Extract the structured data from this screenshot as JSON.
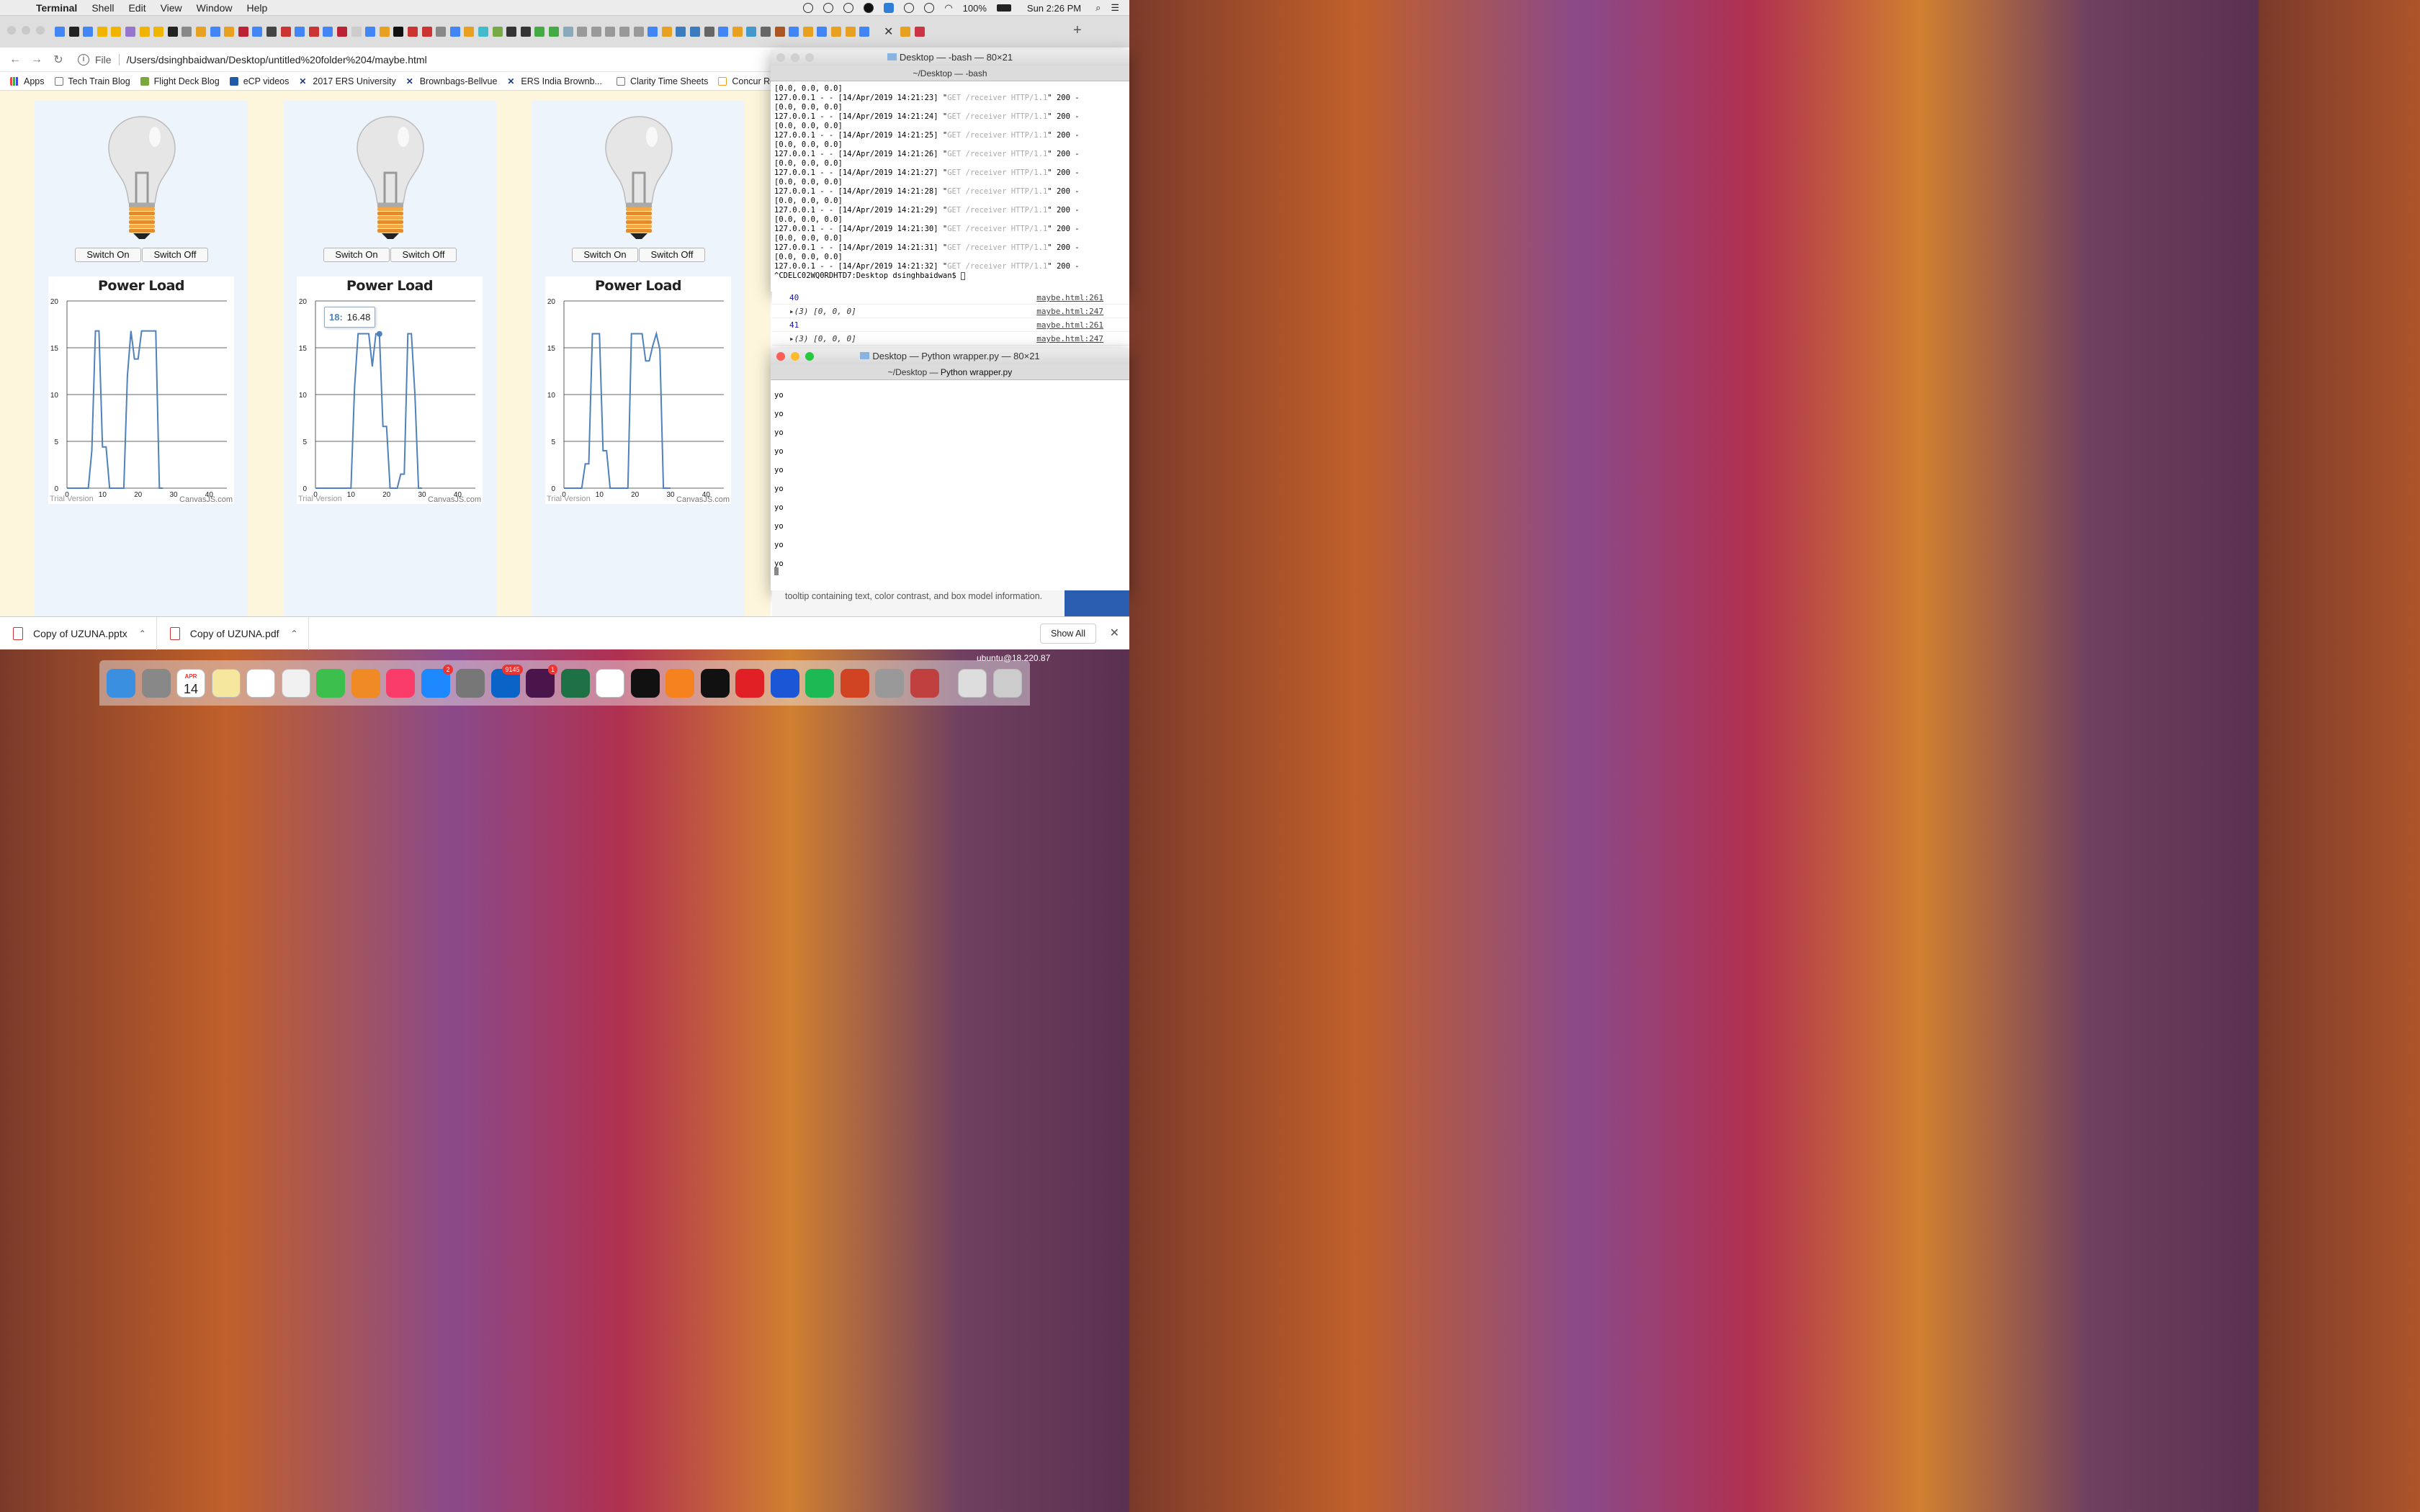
{
  "menubar": {
    "app": "Terminal",
    "items": [
      "Shell",
      "Edit",
      "View",
      "Window",
      "Help"
    ],
    "battery": "100%",
    "clock": "Sun 2:26 PM"
  },
  "browser": {
    "file_label": "File",
    "url": "/Users/dsinghbaidwan/Desktop/untitled%20folder%204/maybe.html",
    "bookmarks": [
      "Apps",
      "Tech Train Blog",
      "Flight Deck Blog",
      "eCP videos",
      "2017 ERS University",
      "Brownbags-Bellvue",
      "ERS India Brownb...",
      "Clarity Time Sheets",
      "Concur Refu"
    ]
  },
  "page": {
    "switch_on": "Switch On",
    "switch_off": "Switch Off",
    "chart_title": "Power Load",
    "trial": "Trial Version",
    "canvasjs": "CanvasJS.com",
    "tooltip_key": "18:",
    "tooltip_val": "16.48"
  },
  "chart_data": [
    {
      "type": "line",
      "title": "Power Load",
      "xlim": [
        0,
        45
      ],
      "ylim": [
        0,
        20
      ],
      "xticks": [
        0,
        10,
        20,
        30,
        40
      ],
      "yticks": [
        0,
        5,
        10,
        15,
        20
      ],
      "x": [
        0,
        1,
        2,
        3,
        4,
        5,
        6,
        7,
        8,
        9,
        10,
        11,
        12,
        13,
        14,
        15,
        16,
        17,
        18,
        19,
        20,
        21,
        22,
        23,
        24,
        25,
        26,
        27
      ],
      "y": [
        0,
        0,
        0,
        0,
        0,
        0,
        0,
        4,
        16.8,
        16.8,
        4.4,
        4.4,
        0,
        0,
        0,
        0,
        0,
        12,
        16.8,
        13.8,
        13.8,
        16.8,
        16.8,
        16.8,
        16.8,
        16.8,
        0,
        0
      ]
    },
    {
      "type": "line",
      "title": "Power Load",
      "xlim": [
        0,
        45
      ],
      "ylim": [
        0,
        20
      ],
      "xticks": [
        0,
        10,
        20,
        30,
        40
      ],
      "yticks": [
        0,
        5,
        10,
        15,
        20
      ],
      "x": [
        0,
        1,
        2,
        3,
        4,
        5,
        6,
        7,
        8,
        9,
        10,
        11,
        12,
        13,
        14,
        15,
        16,
        17,
        18,
        19,
        20,
        21,
        22,
        23,
        24,
        25,
        26,
        27,
        28,
        29,
        30
      ],
      "y": [
        0,
        0,
        0,
        0,
        0,
        0,
        0,
        0,
        0,
        0,
        0,
        10.8,
        16.5,
        16.5,
        16.5,
        16.5,
        13,
        16.5,
        16.48,
        6.6,
        6.6,
        0,
        0,
        0,
        1.5,
        1.5,
        16.5,
        16.5,
        10,
        0,
        0
      ]
    },
    {
      "type": "line",
      "title": "Power Load",
      "xlim": [
        0,
        45
      ],
      "ylim": [
        0,
        20
      ],
      "xticks": [
        0,
        10,
        20,
        30,
        40
      ],
      "yticks": [
        0,
        5,
        10,
        15,
        20
      ],
      "x": [
        0,
        1,
        2,
        3,
        4,
        5,
        6,
        7,
        8,
        9,
        10,
        11,
        12,
        13,
        14,
        15,
        16,
        17,
        18,
        19,
        20,
        21,
        22,
        23,
        24,
        25,
        26,
        27,
        28,
        29,
        30
      ],
      "y": [
        0,
        0,
        0,
        0,
        0,
        0,
        2.6,
        2.6,
        16.5,
        16.5,
        16.5,
        4,
        4,
        0,
        0,
        0,
        0,
        0,
        0,
        16.5,
        16.5,
        16.5,
        16.5,
        13.6,
        13.6,
        15.2,
        16.5,
        14.8,
        0,
        0,
        0
      ]
    }
  ],
  "terminal1": {
    "title": "Desktop — -bash — 80×21",
    "subtitle": "~/Desktop — -bash",
    "lines": [
      {
        "a": "[0.0, 0.0, 0.0]",
        "b": "",
        "c": ""
      },
      {
        "a": "127.0.0.1 - - [14/Apr/2019 14:21:23] \"",
        "b": "GET /receiver HTTP/1.1",
        "c": "\" 200 -"
      },
      {
        "a": "[0.0, 0.0, 0.0]",
        "b": "",
        "c": ""
      },
      {
        "a": "127.0.0.1 - - [14/Apr/2019 14:21:24] \"",
        "b": "GET /receiver HTTP/1.1",
        "c": "\" 200 -"
      },
      {
        "a": "[0.0, 0.0, 0.0]",
        "b": "",
        "c": ""
      },
      {
        "a": "127.0.0.1 - - [14/Apr/2019 14:21:25] \"",
        "b": "GET /receiver HTTP/1.1",
        "c": "\" 200 -"
      },
      {
        "a": "[0.0, 0.0, 0.0]",
        "b": "",
        "c": ""
      },
      {
        "a": "127.0.0.1 - - [14/Apr/2019 14:21:26] \"",
        "b": "GET /receiver HTTP/1.1",
        "c": "\" 200 -"
      },
      {
        "a": "[0.0, 0.0, 0.0]",
        "b": "",
        "c": ""
      },
      {
        "a": "127.0.0.1 - - [14/Apr/2019 14:21:27] \"",
        "b": "GET /receiver HTTP/1.1",
        "c": "\" 200 -"
      },
      {
        "a": "[0.0, 0.0, 0.0]",
        "b": "",
        "c": ""
      },
      {
        "a": "127.0.0.1 - - [14/Apr/2019 14:21:28] \"",
        "b": "GET /receiver HTTP/1.1",
        "c": "\" 200 -"
      },
      {
        "a": "[0.0, 0.0, 0.0]",
        "b": "",
        "c": ""
      },
      {
        "a": "127.0.0.1 - - [14/Apr/2019 14:21:29] \"",
        "b": "GET /receiver HTTP/1.1",
        "c": "\" 200 -"
      },
      {
        "a": "[0.0, 0.0, 0.0]",
        "b": "",
        "c": ""
      },
      {
        "a": "127.0.0.1 - - [14/Apr/2019 14:21:30] \"",
        "b": "GET /receiver HTTP/1.1",
        "c": "\" 200 -"
      },
      {
        "a": "[0.0, 0.0, 0.0]",
        "b": "",
        "c": ""
      },
      {
        "a": "127.0.0.1 - - [14/Apr/2019 14:21:31] \"",
        "b": "GET /receiver HTTP/1.1",
        "c": "\" 200 -"
      },
      {
        "a": "[0.0, 0.0, 0.0]",
        "b": "",
        "c": ""
      },
      {
        "a": "127.0.0.1 - - [14/Apr/2019 14:21:32] \"",
        "b": "GET /receiver HTTP/1.1",
        "c": "\" 200 -"
      },
      {
        "a": "^CDELC02WQ0RDHTD7:Desktop dsinghbaidwan$ ",
        "b": "",
        "c": ""
      }
    ]
  },
  "devtools": {
    "rows": [
      {
        "text": "40",
        "kind": "v",
        "src": "maybe.html:261"
      },
      {
        "text": "▸(3) [0, 0, 0]",
        "kind": "a",
        "src": "maybe.html:247"
      },
      {
        "text": "41",
        "kind": "v",
        "src": "maybe.html:261"
      },
      {
        "text": "▸(3) [0, 0, 0]",
        "kind": "a",
        "src": "maybe.html:247"
      }
    ],
    "bottom_text": "tooltip containing text, color contrast, and box model information."
  },
  "terminal2": {
    "title": "Desktop — Python wrapper.py — 80×21",
    "subtitle_prefix": "~/Desktop — ",
    "subtitle_bold": "Python wrapper.py",
    "lines": [
      "yo",
      "yo",
      "yo",
      "yo",
      "yo",
      "yo",
      "yo",
      "yo",
      "yo",
      "yo"
    ]
  },
  "downloads": {
    "items": [
      "Copy of UZUNA.pptx",
      "Copy of UZUNA.pdf"
    ],
    "show_all": "Show All"
  },
  "dock": {
    "ubuntu_label": "ubuntu@18.220.87",
    "calendar_month": "APR",
    "calendar_day": "14",
    "badges": {
      "appstore": "2",
      "outlook": "9145",
      "slack": "1"
    },
    "apps": [
      "Finder",
      "Launchpad",
      "Calendar",
      "Notes",
      "Reminders",
      "Photos",
      "FaceTime",
      "Books",
      "Music",
      "App Store",
      "System Preferences",
      "Outlook",
      "Slack",
      "Excel",
      "Chrome",
      "IntelliJ IDEA",
      "Sublime Text",
      "Terminal",
      "Acrobat",
      "BBEdit",
      "Spotify",
      "PowerPoint",
      "Keychain",
      "Remote Desktop",
      "Documents",
      "Trash"
    ],
    "colors": [
      "#3a8fe0",
      "#888",
      "#fff",
      "#f5e79e",
      "#fff",
      "#f0f0f0",
      "#3cbf4c",
      "#f08a24",
      "#fa3c6a",
      "#1e88ff",
      "#777",
      "#0a64c8",
      "#4a154b",
      "#1d7145",
      "#fff",
      "#111",
      "#f5821f",
      "#111",
      "#e12026",
      "#1a56d6",
      "#1db954",
      "#d04423",
      "#999",
      "#c04040",
      "#ddd",
      "#ccc"
    ]
  },
  "colors": {
    "accent": "#4f81bc",
    "page_bg": "#fdf6dc",
    "panel_bg": "#eef4fc"
  }
}
